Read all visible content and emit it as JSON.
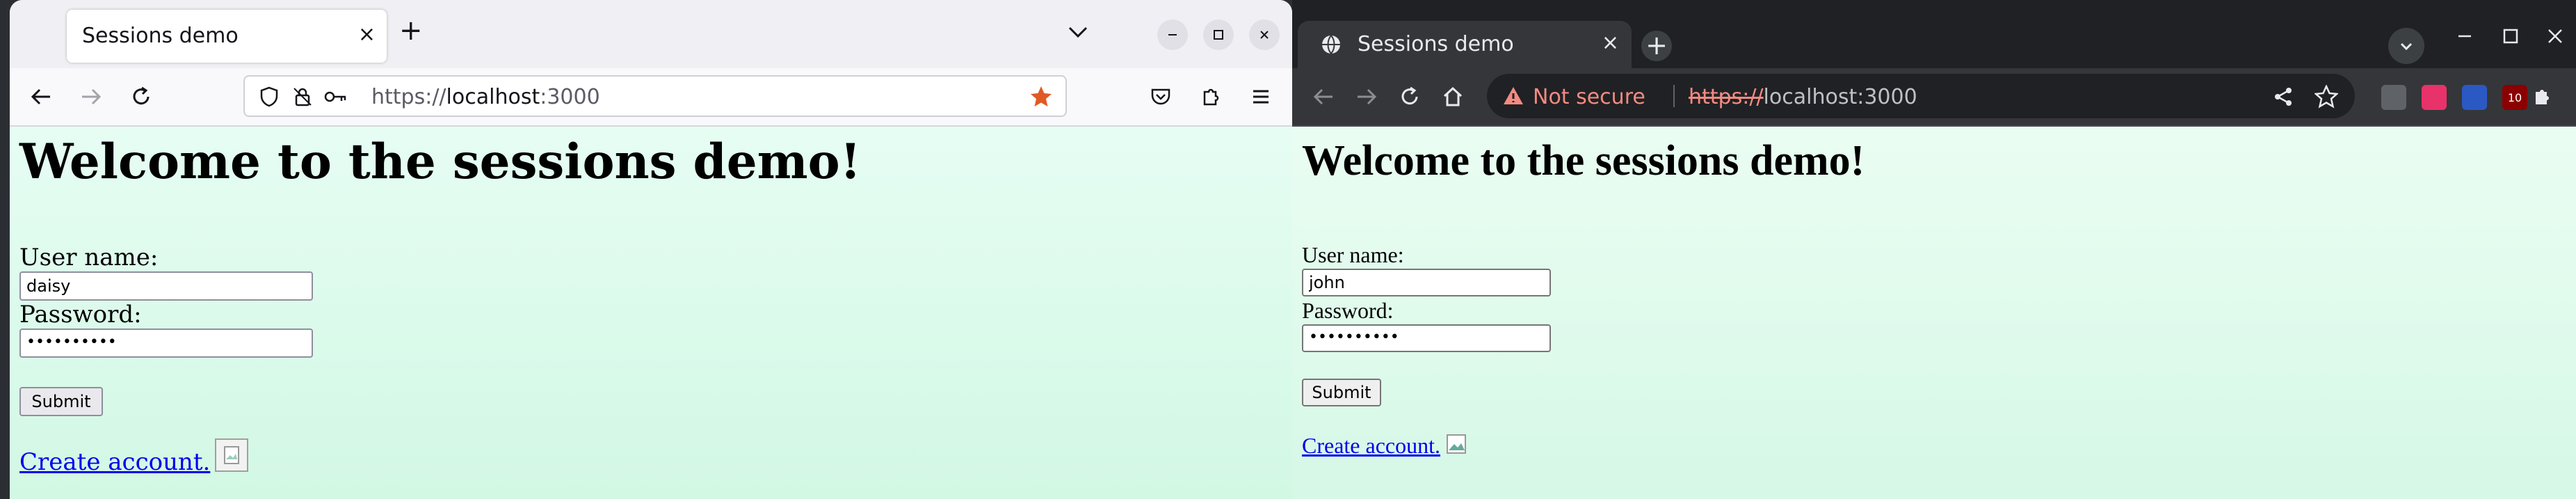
{
  "firefox": {
    "tab_title": "Sessions demo",
    "tab_close": "×",
    "new_tab": "+",
    "url_scheme": "https://",
    "url_host": "localhost",
    "url_port": ":3000",
    "page": {
      "heading": "Welcome to the sessions demo!",
      "username_label": "User name:",
      "username_value": "daisy",
      "password_label": "Password:",
      "password_mask": "••••••••••",
      "submit_label": "Submit",
      "create_account_link": "Create account."
    }
  },
  "chrome": {
    "tab_title": "Sessions demo",
    "tab_close": "×",
    "new_tab": "+",
    "not_secure_label": "Not secure",
    "url_scheme": "https://",
    "url_rest": "localhost:3000",
    "extension_badge": "10",
    "page": {
      "heading": "Welcome to the sessions demo!",
      "username_label": "User name:",
      "username_value": "john",
      "password_label": "Password:",
      "password_mask": "••••••••••",
      "submit_label": "Submit",
      "create_account_link": "Create account."
    }
  },
  "colors": {
    "firefox_page_bg": "#e6fdf3",
    "chrome_page_bg": "#eafdf2",
    "link": "#0000ee",
    "firefox_bookmark_star": "#e05a26",
    "chrome_not_secure": "#f28b82"
  },
  "icons": {
    "firefox": [
      "close-icon",
      "plus-icon",
      "chevron-down-icon",
      "minimize-icon",
      "maximize-icon",
      "back-arrow-icon",
      "forward-arrow-icon",
      "reload-icon",
      "shield-icon",
      "lock-icon",
      "key-icon",
      "bookmark-star-icon",
      "pocket-icon",
      "extensions-icon",
      "menu-icon",
      "broken-image-icon"
    ],
    "chrome": [
      "globe-icon",
      "close-icon",
      "plus-icon",
      "tab-search-icon",
      "minimize-icon",
      "maximize-icon",
      "back-arrow-icon",
      "forward-arrow-icon",
      "reload-icon",
      "home-icon",
      "warning-icon",
      "share-icon",
      "bookmark-star-icon",
      "puzzle-icon",
      "side-panel-icon",
      "avatar-icon",
      "kebab-menu-icon",
      "broken-image-icon"
    ]
  }
}
